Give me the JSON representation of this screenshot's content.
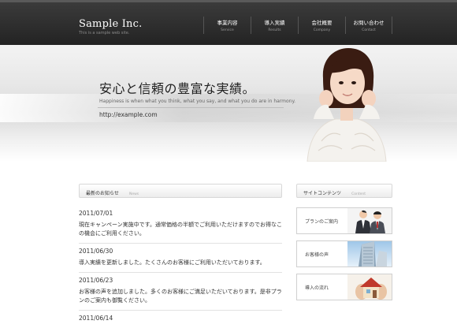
{
  "header": {
    "logo_title": "Sample Inc.",
    "logo_subtitle": "This is a sample web site.",
    "nav": [
      {
        "label": "事業内容",
        "sub": "Service"
      },
      {
        "label": "導入実績",
        "sub": "Results"
      },
      {
        "label": "会社概要",
        "sub": "Company"
      },
      {
        "label": "お問い合わせ",
        "sub": "Contact"
      }
    ]
  },
  "hero": {
    "title": "安心と信頼の豊富な実績。",
    "subtitle": "Happiness is when what you think, what you say, and what you do are in harmony.",
    "url": "http://example.com"
  },
  "news": {
    "heading": "最新のお知らせ",
    "heading_sub": "News",
    "items": [
      {
        "date": "2011/07/01",
        "text": "現在キャンペーン実施中です。通常価格の半額でご利用いただけますのでお得なこの機会にご利用ください。"
      },
      {
        "date": "2011/06/30",
        "text": "導入実績を更新しました。たくさんのお客様にご利用いただいております。"
      },
      {
        "date": "2011/06/23",
        "text": "お客様の声を追加しました。多くのお客様にご満足いただいております。是非プランのご案内も御覧ください。"
      },
      {
        "date": "2011/06/14",
        "text": ""
      }
    ]
  },
  "sidebar": {
    "heading": "サイトコンテンツ",
    "heading_sub": "Content",
    "banners": [
      {
        "label": "プランのご案内",
        "icon": "business-people-image"
      },
      {
        "label": "お客様の声",
        "icon": "office-building-image"
      },
      {
        "label": "導入の流れ",
        "icon": "house-model-image"
      }
    ]
  },
  "colors": {
    "header_bg": "#2b2b2b",
    "nav_text": "#ffffff",
    "body_text": "#333333"
  }
}
